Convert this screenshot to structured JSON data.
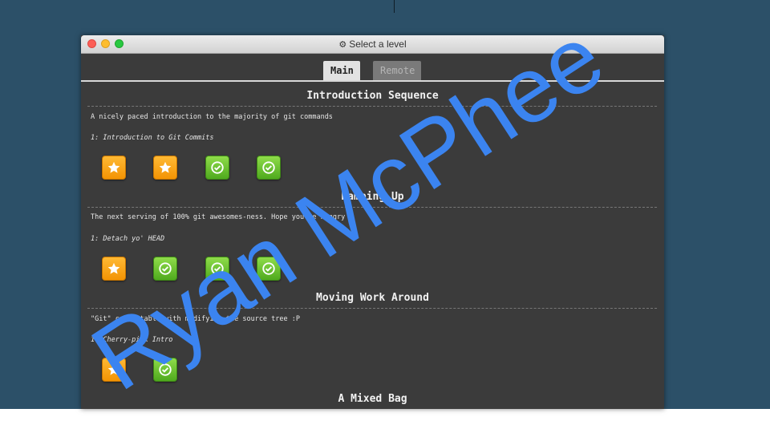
{
  "window": {
    "title": "Select a level"
  },
  "tabs": [
    {
      "label": "Main",
      "active": true
    },
    {
      "label": "Remote",
      "active": false
    }
  ],
  "sections": [
    {
      "title": "Introduction Sequence",
      "description": "A nicely paced introduction to the majority of git commands",
      "subtitle": "1: Introduction to Git Commits",
      "icons": [
        "star-icon",
        "star-icon",
        "check-icon",
        "check-icon"
      ]
    },
    {
      "title": "Ramping Up",
      "description": "The next serving of 100% git awesomes-ness. Hope you're hungry",
      "subtitle": "1: Detach yo' HEAD",
      "icons": [
        "star-icon",
        "check-icon",
        "check-icon",
        "check-icon"
      ]
    },
    {
      "title": "Moving Work Around",
      "description": "\"Git\" comfortable with modifying the source tree :P",
      "subtitle": "1: Cherry-pick Intro",
      "icons": [
        "star-icon",
        "check-icon"
      ]
    },
    {
      "title": "A Mixed Bag"
    }
  ],
  "watermark": {
    "text": "Ryan McPhee",
    "color": "#3b84f0"
  },
  "colors": {
    "background": "#2c5068",
    "panel": "#3b3b3b",
    "star": "#f5a00a",
    "check": "#62bd2a"
  }
}
